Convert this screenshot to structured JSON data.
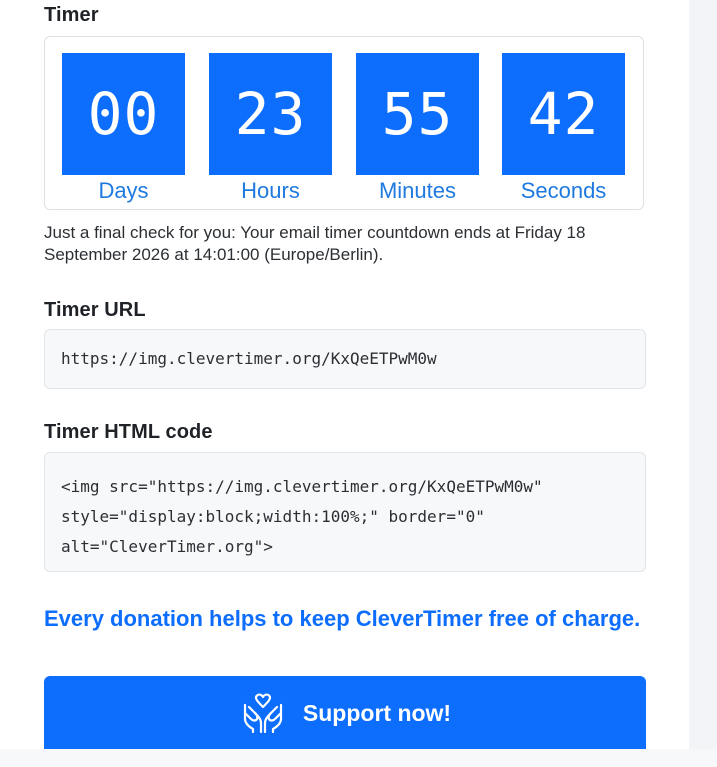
{
  "timer_section": {
    "heading": "Timer",
    "units": [
      {
        "value": "00",
        "label": "Days"
      },
      {
        "value": "23",
        "label": "Hours"
      },
      {
        "value": "55",
        "label": "Minutes"
      },
      {
        "value": "42",
        "label": "Seconds"
      }
    ],
    "note": "Just a final check for you: Your email timer countdown ends at Friday 18 September 2026 at 14:01:00 (Europe/Berlin)."
  },
  "timer_url": {
    "heading": "Timer URL",
    "value": "https://img.clevertimer.org/KxQeETPwM0w"
  },
  "timer_html_code": {
    "heading": "Timer HTML code",
    "lines": [
      "<img src=\"https://img.clevertimer.org/KxQeETPwM0w\"",
      "style=\"display:block;width:100%;\" border=\"0\"",
      "alt=\"CleverTimer.org\">"
    ]
  },
  "donation": {
    "message": "Every donation helps to keep CleverTimer free of charge.",
    "button_label": "Support now!",
    "button_icon": "hands-heart-icon"
  },
  "colors": {
    "accent": "#0d6efd",
    "label": "#1f7ae0"
  }
}
